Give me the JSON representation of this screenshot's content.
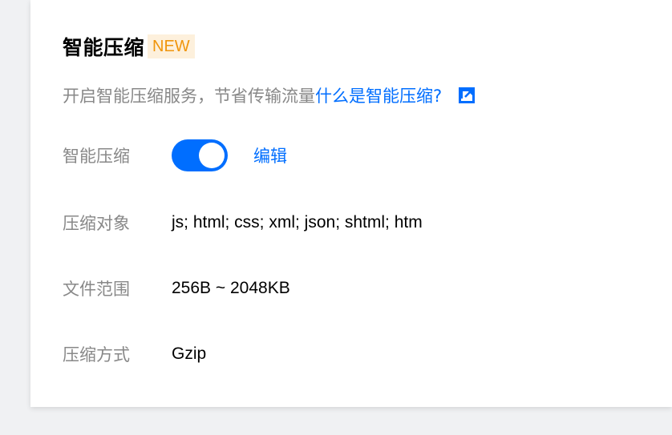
{
  "section": {
    "title": "智能压缩",
    "badge": "NEW",
    "description": "开启智能压缩服务，节省传输流量",
    "help_link": "什么是智能压缩?"
  },
  "fields": {
    "smart_compression": {
      "label": "智能压缩",
      "enabled": true,
      "edit_label": "编辑"
    },
    "compression_target": {
      "label": "压缩对象",
      "value": "js; html; css; xml; json; shtml; htm"
    },
    "file_range": {
      "label": "文件范围",
      "value": "256B ~ 2048KB"
    },
    "compression_method": {
      "label": "压缩方式",
      "value": "Gzip"
    }
  },
  "colors": {
    "accent": "#006eff",
    "badge_text": "#f0950c",
    "badge_bg": "#fdf0dc",
    "label_gray": "#888888"
  },
  "icons": {
    "external_link": "external-link-icon"
  }
}
